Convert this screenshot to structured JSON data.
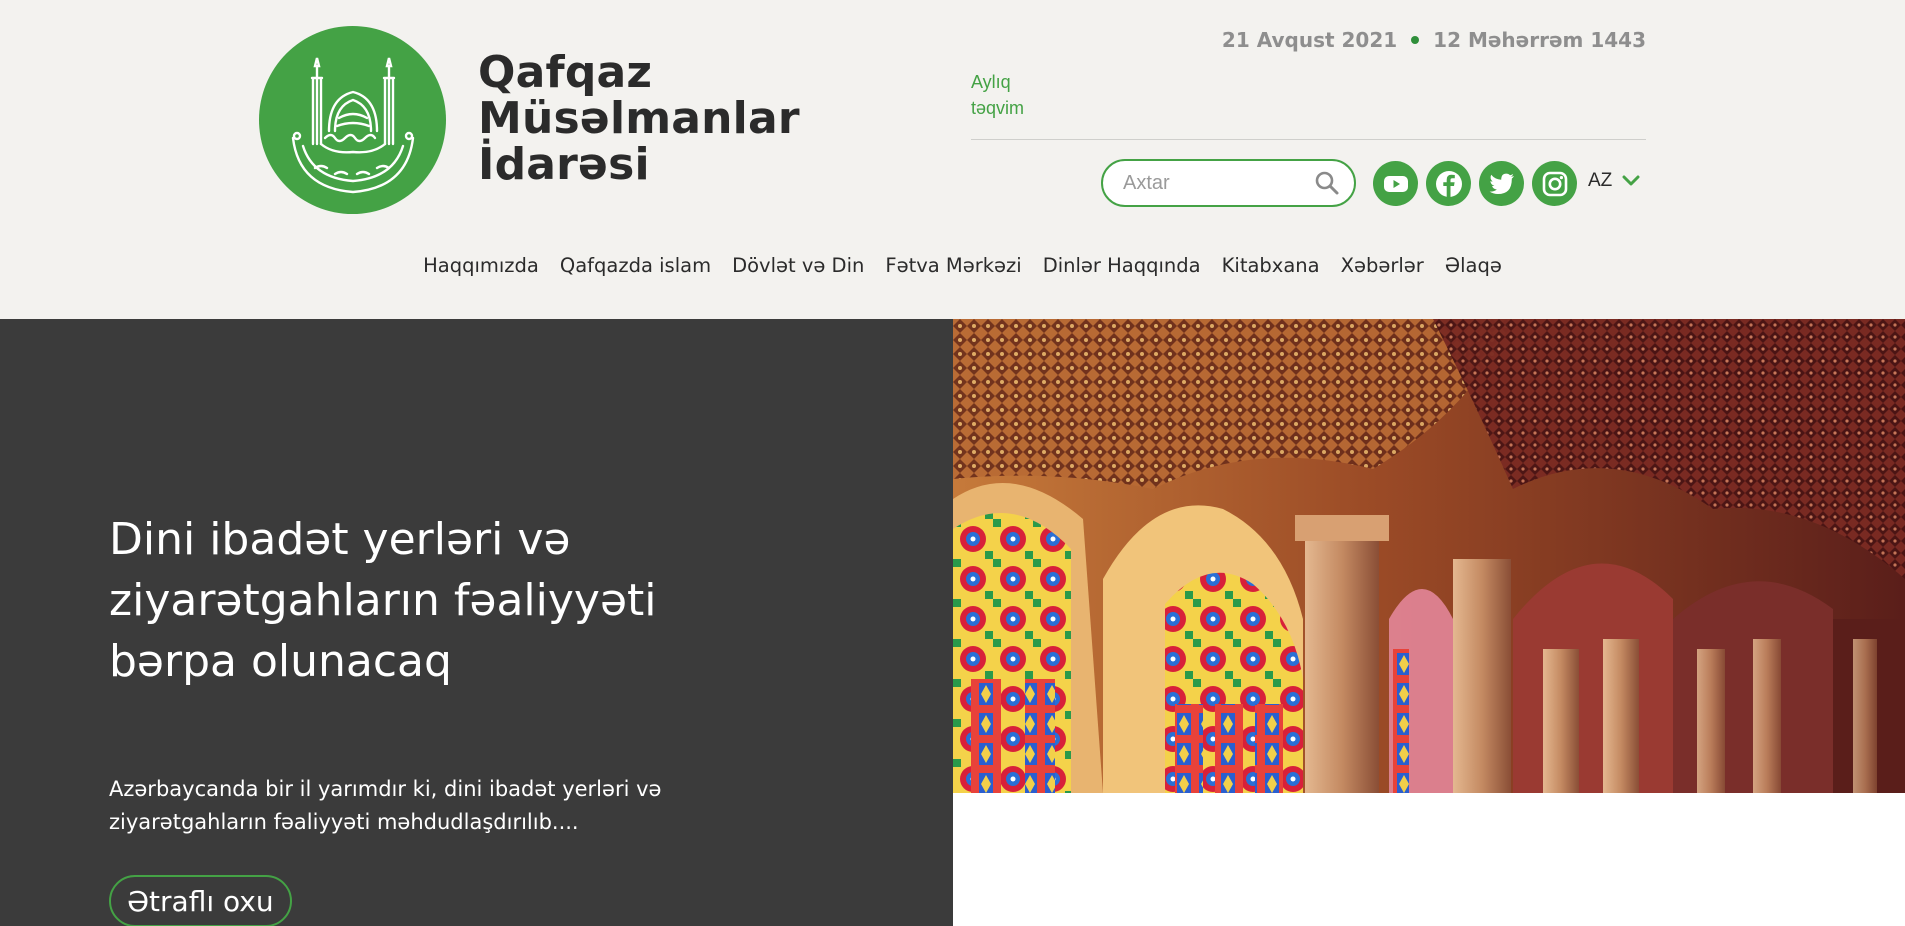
{
  "org": {
    "name_lines": [
      "Qafqaz",
      "Müsəlmanlar",
      "İdarəsi"
    ]
  },
  "dates": {
    "gregorian": "21 Avqust 2021",
    "hijri": "12 Məhərrəm 1443"
  },
  "calendar_link": {
    "line1": "Aylıq",
    "line2": "təqvim"
  },
  "search": {
    "placeholder": "Axtar"
  },
  "socials": [
    "youtube-icon",
    "facebook-icon",
    "twitter-icon",
    "instagram-icon"
  ],
  "language": {
    "selected": "AZ"
  },
  "nav": {
    "items": [
      "Haqqımızda",
      "Qafqazda islam",
      "Dövlət və Din",
      "Fətva Mərkəzi",
      "Dinlər Haqqında",
      "Kitabxana",
      "Xəbərlər",
      "Əlaqə"
    ]
  },
  "hero": {
    "title": "Dini ibadət yerləri və ziyarətgahların fəaliyyəti bərpa olunacaq",
    "excerpt": "Azərbaycanda bir il yarımdır ki, dini ibadət yerləri və ziyarətgahların fəaliyyəti məhdudlaşdırılıb....",
    "button_label": "Ətraflı oxu"
  },
  "colors": {
    "brand_green": "#44a245",
    "header_bg": "#f3f2ef",
    "hero_dark": "#3b3b3b"
  }
}
